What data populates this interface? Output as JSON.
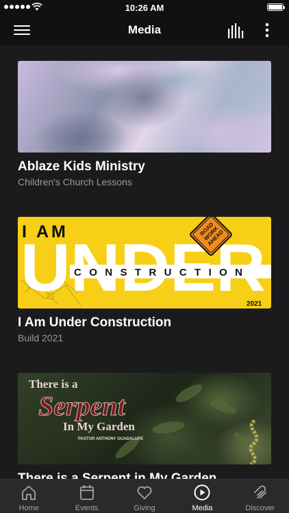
{
  "status": {
    "time": "10:26 AM"
  },
  "nav": {
    "title": "Media",
    "menu_icon": "hamburger-menu-icon",
    "audio_icon": "equalizer-icon",
    "more_icon": "more-vertical-icon"
  },
  "media": [
    {
      "title": "Ablaze Kids Ministry",
      "subtitle": "Children's Church Lessons"
    },
    {
      "title": "I Am Under Construction",
      "subtitle": "Build 2021",
      "art": {
        "line1": "I AM",
        "line2": "UNDER",
        "line3": "CONSTRUCTION",
        "sign": [
          "ROAD",
          "WORK",
          "AHEAD"
        ],
        "year": "2021"
      }
    },
    {
      "title": "There is a Serpent in My Garden",
      "subtitle": "",
      "art": {
        "line1": "There is a",
        "line2": "Serpent",
        "line3": "In My Garden",
        "credit": "PASTOR ANTHONY GUADALUPE"
      }
    }
  ],
  "tabs": [
    {
      "label": "Home",
      "icon": "home-icon",
      "active": false
    },
    {
      "label": "Events",
      "icon": "calendar-icon",
      "active": false
    },
    {
      "label": "Giving",
      "icon": "heart-icon",
      "active": false
    },
    {
      "label": "Media",
      "icon": "play-circle-icon",
      "active": true
    },
    {
      "label": "Discover",
      "icon": "discover-icon",
      "active": false
    }
  ],
  "colors": {
    "background": "#1b1b1d",
    "bars": "#111111",
    "tab_bar": "#2a2a2c",
    "subtitle": "#9a9a9a",
    "construction_yellow": "#f7cf16"
  }
}
